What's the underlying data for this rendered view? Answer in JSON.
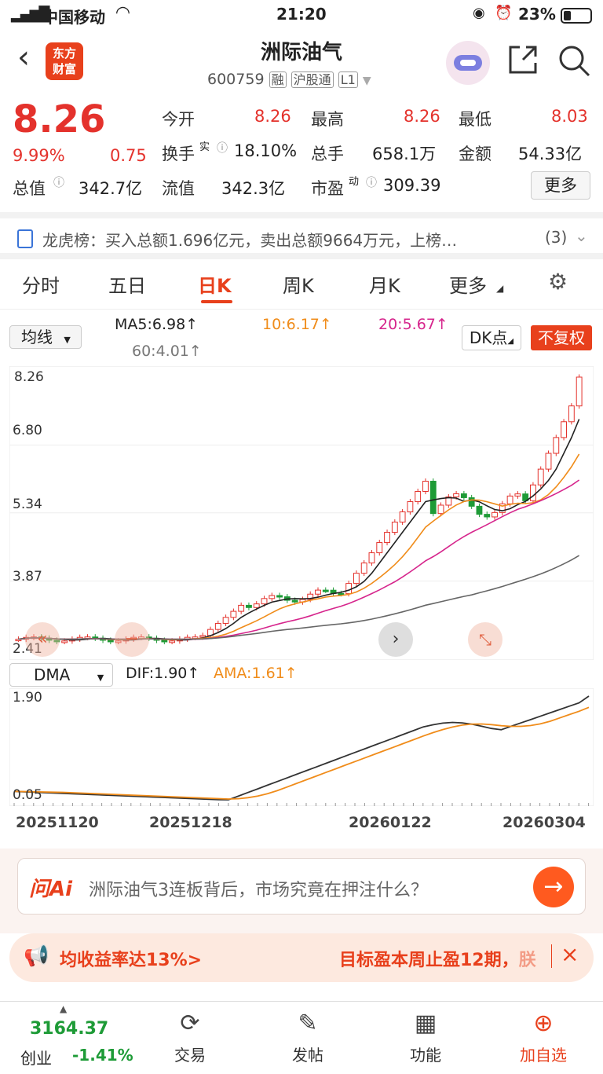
{
  "status": {
    "carrier": "中国移动",
    "time": "21:20",
    "battery": "23%"
  },
  "header": {
    "logo_top": "东方",
    "logo_bottom": "财富",
    "title": "洲际油气",
    "code": "600759",
    "badge_rong": "融",
    "badge_hgt": "沪股通",
    "badge_level": "L1"
  },
  "quote": {
    "price": "8.26",
    "pct": "9.99%",
    "chg": "0.75",
    "open_label": "今开",
    "open": "8.26",
    "high_label": "最高",
    "high": "8.26",
    "low_label": "最低",
    "low": "8.03",
    "turnover_label": "换手",
    "turnover_sup": "实",
    "turnover": "18.10%",
    "volume_label": "总手",
    "volume": "658.1万",
    "amount_label": "金额",
    "amount": "54.33亿",
    "mktcap_label": "总值",
    "mktcap": "342.7亿",
    "float_label": "流值",
    "float": "342.3亿",
    "pe_label": "市盈",
    "pe_sup": "动",
    "pe": "309.39",
    "more": "更多"
  },
  "lhb": {
    "text": "龙虎榜：买入总额1.696亿元，卖出总额9664万元，上榜…",
    "count": "(3)"
  },
  "tabs": [
    "分时",
    "五日",
    "日K",
    "周K",
    "月K",
    "更多"
  ],
  "active_tab": 2,
  "ma": {
    "select": "均线",
    "ma5": "MA5:6.98",
    "ma10": "10:6.17",
    "ma20": "20:5.67",
    "ma60": "60:4.01",
    "dk": "DK点",
    "fq": "不复权"
  },
  "chart_axis": {
    "y1": "8.26",
    "y2": "6.80",
    "y3": "5.34",
    "y4": "3.87",
    "y5": "2.41"
  },
  "sub": {
    "select": "DMA",
    "dif": "DIF:1.90",
    "ama": "AMA:1.61"
  },
  "sub_axis": {
    "top": "1.90",
    "bottom": "0.05"
  },
  "dates": [
    "20251120",
    "20251218",
    "20260122",
    "20260304"
  ],
  "ai": {
    "logo": "问Ai",
    "question": "洲际油气3连板背后，市场究竟在押注什么？"
  },
  "banner": {
    "left": "均收益率达13%>",
    "right": "目标盈本周止盈12期，",
    "right_tail": "朕"
  },
  "bottom_nav": {
    "index_value": "3164.37",
    "index_name": "创业",
    "index_pct": "-1.41%",
    "trade": "交易",
    "post": "发帖",
    "func": "功能",
    "fav": "加自选"
  },
  "colors": {
    "up": "#e4322c",
    "down": "#1e9b37",
    "ma10": "#f08c1a",
    "ma20": "#d6258c",
    "ma60": "#666666",
    "accent": "#ff6a00"
  }
}
